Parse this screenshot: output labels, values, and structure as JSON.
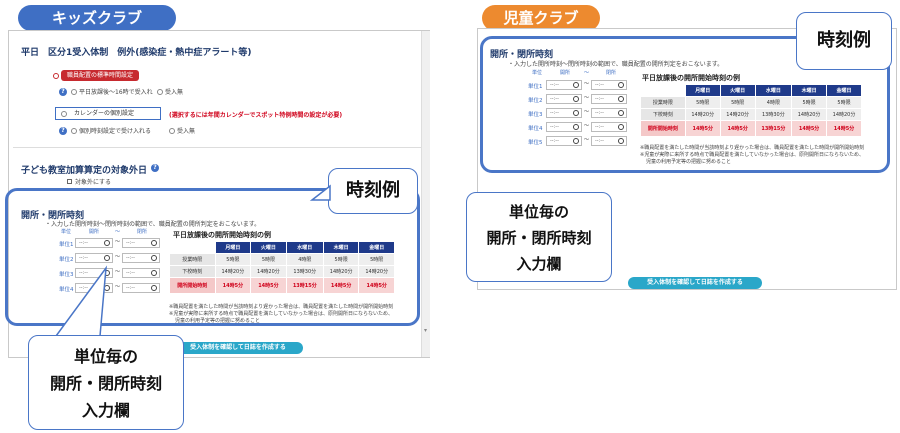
{
  "tags": {
    "kids": "キッズクラブ",
    "jido": "児童クラブ"
  },
  "left": {
    "section1_title": "平日　区分1受入体制　例外(感染症・熱中症アラート等)",
    "staff_button": "職員配置の標準時間設定",
    "opt1a": "平日放課後～16時で受入れ",
    "opt1b": "受入無",
    "calendar_button": "カレンダーの個別設定",
    "calendar_note": "(選択するには年間カレンダーでスポット特例時間の設定が必要)",
    "opt2a": "個別時刻設定で受け入れる",
    "opt2b": "受入無",
    "section2_title": "子ども教室加算算定の対象外日",
    "section2_check": "対象外にする",
    "section3_title": "開所・閉所時刻",
    "section3_desc": "・入力した開所時刻～閉所時刻の範囲で、職員配置の開所判定をおこないます。",
    "col_unit": "単位",
    "col_open": "開所",
    "col_tilde": "～",
    "col_close": "閉所",
    "units": [
      "単位1",
      "単位2",
      "単位3",
      "単位4"
    ],
    "time_placeholder": "--:--",
    "button": "受入体制を確認して日誌を作成する"
  },
  "right": {
    "section_title": "開所・閉所時刻",
    "desc": "・入力した開所時刻～閉所時刻の範囲で、職員配置の開所判定をおこないます。",
    "col_unit": "単位",
    "col_open": "開所",
    "col_tilde": "～",
    "col_close": "閉所",
    "units": [
      "単位1",
      "単位2",
      "単位3",
      "単位4",
      "単位5"
    ],
    "time_placeholder": "--:--",
    "button": "受入体制を確認して日誌を作成する"
  },
  "example": {
    "title": "平日放課後の開所開始時刻の例",
    "days": [
      "月曜日",
      "火曜日",
      "水曜日",
      "木曜日",
      "金曜日"
    ],
    "rows": [
      {
        "label": "授業時限",
        "values": [
          "5時限",
          "5時限",
          "4時限",
          "5時限",
          "5時限"
        ]
      },
      {
        "label": "下校時刻",
        "values": [
          "14時20分",
          "14時20分",
          "13時30分",
          "14時20分",
          "14時20分"
        ]
      },
      {
        "label": "開所開始時刻",
        "values": [
          "14時5分",
          "14時5分",
          "13時15分",
          "14時5分",
          "14時5分"
        ]
      }
    ],
    "note1": "※職員配置を満たした時間が当該時刻より遅かった場合は、職員配置を満たした時間が開所開始時刻",
    "note2": "※児童が実際に来所する時点で職員配置を満たしていなかった場合は、原則開所日にならないため、",
    "note3": "児童の利用予定等の把握に努めること"
  },
  "callouts": {
    "example_left": "時刻例",
    "example_right": "時刻例",
    "input_left": [
      "単位毎の",
      "開所・閉所時刻",
      "入力欄"
    ],
    "input_right": [
      "単位毎の",
      "開所・閉所時刻",
      "入力欄"
    ]
  }
}
